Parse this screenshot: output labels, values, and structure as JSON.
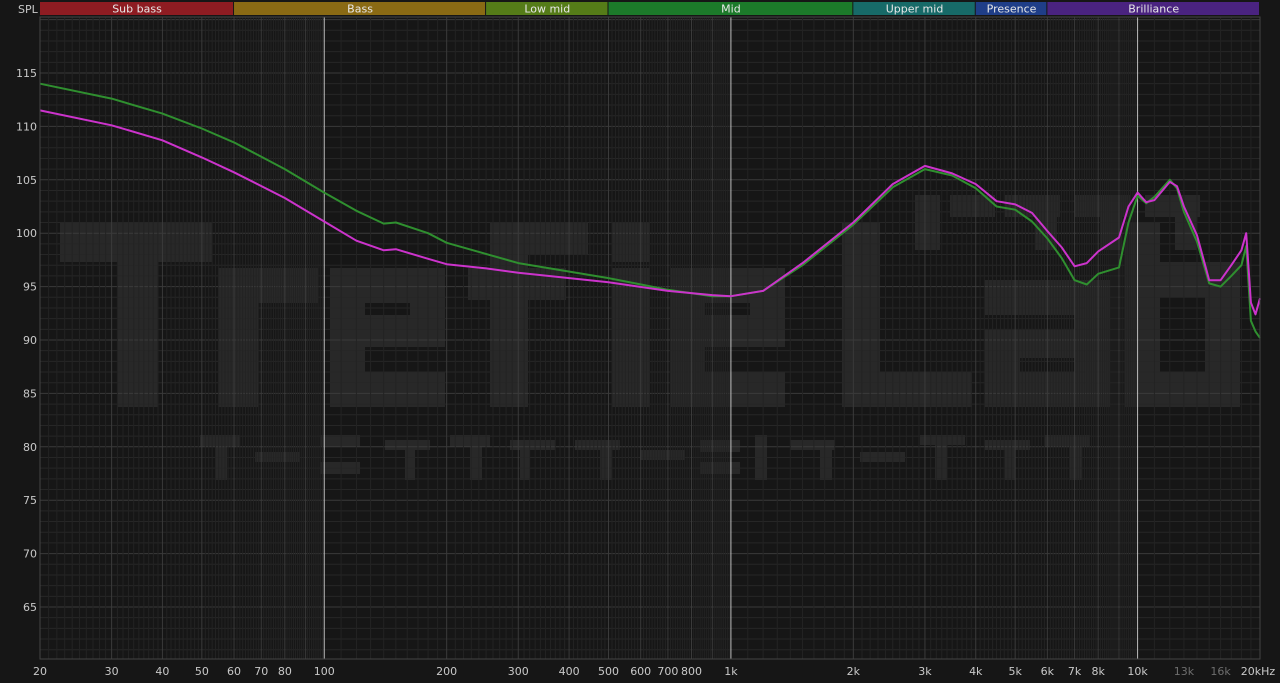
{
  "chart_data": {
    "type": "line",
    "ylabel": "SPL",
    "x_scale": "log",
    "xlim": [
      20,
      20000
    ],
    "ylim": [
      60,
      120
    ],
    "grid": true,
    "y_ticks": [
      65,
      70,
      75,
      80,
      85,
      90,
      95,
      100,
      105,
      110,
      115
    ],
    "x_ticks": [
      {
        "v": 20,
        "t": "20"
      },
      {
        "v": 30,
        "t": "30"
      },
      {
        "v": 40,
        "t": "40"
      },
      {
        "v": 50,
        "t": "50"
      },
      {
        "v": 60,
        "t": "60"
      },
      {
        "v": 70,
        "t": "70"
      },
      {
        "v": 80,
        "t": "80"
      },
      {
        "v": 100,
        "t": "100"
      },
      {
        "v": 200,
        "t": "200"
      },
      {
        "v": 300,
        "t": "300"
      },
      {
        "v": 400,
        "t": "400"
      },
      {
        "v": 500,
        "t": "500"
      },
      {
        "v": 600,
        "t": "600"
      },
      {
        "v": 700,
        "t": "700"
      },
      {
        "v": 800,
        "t": "800"
      },
      {
        "v": 1000,
        "t": "1k"
      },
      {
        "v": 2000,
        "t": "2k"
      },
      {
        "v": 3000,
        "t": "3k"
      },
      {
        "v": 4000,
        "t": "4k"
      },
      {
        "v": 5000,
        "t": "5k"
      },
      {
        "v": 6000,
        "t": "6k"
      },
      {
        "v": 7000,
        "t": "7k"
      },
      {
        "v": 8000,
        "t": "8k"
      },
      {
        "v": 10000,
        "t": "10k"
      },
      {
        "v": 13000,
        "t": "13k",
        "dim": true
      },
      {
        "v": 16000,
        "t": "16k",
        "dim": true
      },
      {
        "v": 20000,
        "t": "20kHz"
      }
    ],
    "bands": [
      {
        "name": "Sub bass",
        "from": 20,
        "to": 60,
        "color": "#8e1c22"
      },
      {
        "name": "Bass",
        "from": 60,
        "to": 250,
        "color": "#8a6a14"
      },
      {
        "name": "Low mid",
        "from": 250,
        "to": 500,
        "color": "#557c18"
      },
      {
        "name": "Mid",
        "from": 500,
        "to": 2000,
        "color": "#1c7a2a"
      },
      {
        "name": "Upper mid",
        "from": 2000,
        "to": 4000,
        "color": "#176a68"
      },
      {
        "name": "Presence",
        "from": 4000,
        "to": 6000,
        "color": "#1f3e88"
      },
      {
        "name": "Brilliance",
        "from": 6000,
        "to": 20000,
        "color": "#4a2380"
      }
    ],
    "series": [
      {
        "color": "#2f8f2f",
        "points": [
          [
            20,
            114
          ],
          [
            30,
            112.6
          ],
          [
            40,
            111.2
          ],
          [
            50,
            109.8
          ],
          [
            60,
            108.5
          ],
          [
            80,
            106
          ],
          [
            100,
            103.8
          ],
          [
            120,
            102.1
          ],
          [
            140,
            100.9
          ],
          [
            150,
            101
          ],
          [
            180,
            100
          ],
          [
            200,
            99.1
          ],
          [
            300,
            97.2
          ],
          [
            500,
            95.8
          ],
          [
            700,
            94.7
          ],
          [
            900,
            94.1
          ],
          [
            1000,
            94.1
          ],
          [
            1200,
            94.6
          ],
          [
            1500,
            97
          ],
          [
            2000,
            100.8
          ],
          [
            2500,
            104.3
          ],
          [
            3000,
            106
          ],
          [
            3500,
            105.4
          ],
          [
            4000,
            104.2
          ],
          [
            4500,
            102.5
          ],
          [
            5000,
            102.2
          ],
          [
            5500,
            101.1
          ],
          [
            6000,
            99.5
          ],
          [
            6500,
            97.7
          ],
          [
            7000,
            95.6
          ],
          [
            7500,
            95.2
          ],
          [
            8000,
            96.2
          ],
          [
            9000,
            96.8
          ],
          [
            9500,
            101
          ],
          [
            10000,
            103.5
          ],
          [
            10500,
            102.8
          ],
          [
            11000,
            103.4
          ],
          [
            12000,
            105
          ],
          [
            12500,
            104.2
          ],
          [
            13000,
            102
          ],
          [
            14000,
            99.2
          ],
          [
            15000,
            95.3
          ],
          [
            16000,
            95
          ],
          [
            17000,
            96
          ],
          [
            18000,
            97
          ],
          [
            18500,
            98.8
          ],
          [
            19000,
            91.8
          ],
          [
            19500,
            90.8
          ],
          [
            20000,
            90.2
          ]
        ]
      },
      {
        "color": "#cc33cc",
        "points": [
          [
            20,
            111.5
          ],
          [
            30,
            110.1
          ],
          [
            40,
            108.7
          ],
          [
            50,
            107.1
          ],
          [
            60,
            105.7
          ],
          [
            80,
            103.3
          ],
          [
            100,
            101.1
          ],
          [
            120,
            99.3
          ],
          [
            140,
            98.4
          ],
          [
            150,
            98.5
          ],
          [
            180,
            97.6
          ],
          [
            200,
            97.1
          ],
          [
            250,
            96.7
          ],
          [
            300,
            96.3
          ],
          [
            500,
            95.4
          ],
          [
            700,
            94.6
          ],
          [
            900,
            94.2
          ],
          [
            1000,
            94.1
          ],
          [
            1200,
            94.6
          ],
          [
            1500,
            97.2
          ],
          [
            2000,
            101
          ],
          [
            2500,
            104.6
          ],
          [
            3000,
            106.3
          ],
          [
            3500,
            105.6
          ],
          [
            4000,
            104.6
          ],
          [
            4500,
            103
          ],
          [
            5000,
            102.7
          ],
          [
            5500,
            101.9
          ],
          [
            6000,
            100.2
          ],
          [
            6500,
            98.7
          ],
          [
            7000,
            96.9
          ],
          [
            7500,
            97.2
          ],
          [
            8000,
            98.3
          ],
          [
            9000,
            99.6
          ],
          [
            9500,
            102.5
          ],
          [
            10000,
            103.8
          ],
          [
            10500,
            102.9
          ],
          [
            11000,
            103.1
          ],
          [
            12000,
            104.8
          ],
          [
            12500,
            104.4
          ],
          [
            13000,
            102.5
          ],
          [
            14000,
            99.8
          ],
          [
            15000,
            95.6
          ],
          [
            16000,
            95.6
          ],
          [
            17000,
            97
          ],
          [
            18000,
            98.4
          ],
          [
            18500,
            100
          ],
          [
            19000,
            93.5
          ],
          [
            19500,
            92.4
          ],
          [
            20000,
            93.9
          ]
        ]
      }
    ]
  }
}
